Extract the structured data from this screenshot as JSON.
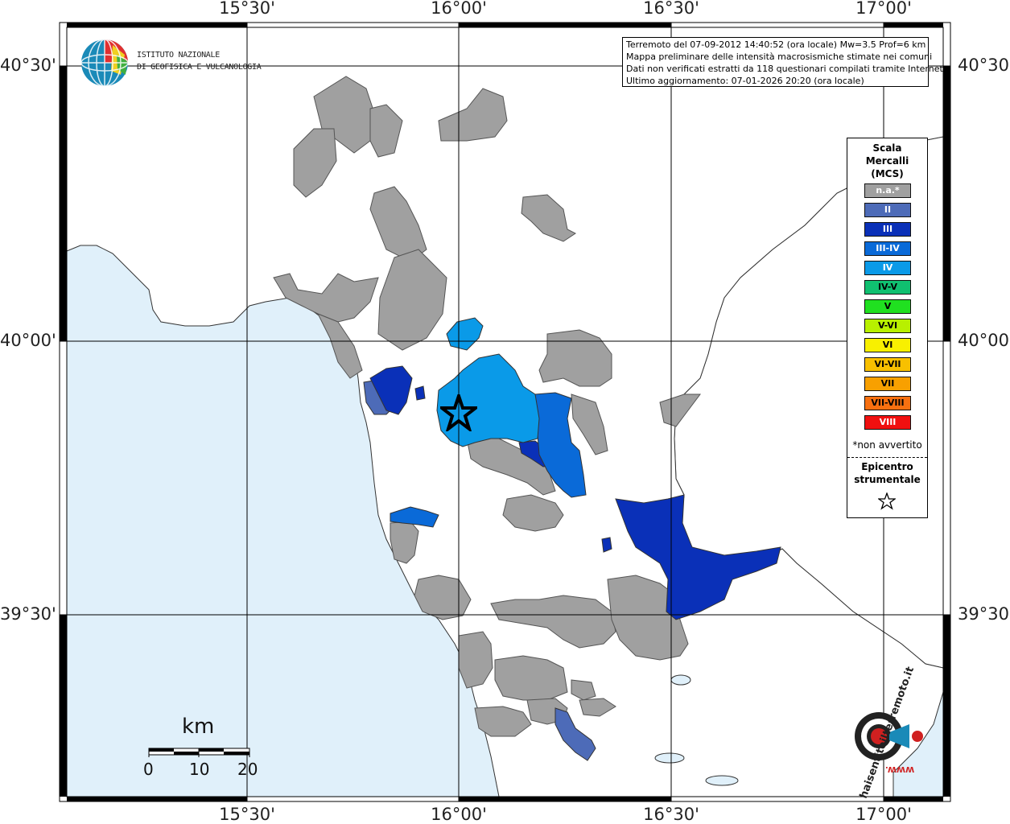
{
  "map": {
    "longitude_labels": [
      "15°30'",
      "16°00'",
      "16°30'",
      "17°00'"
    ],
    "latitude_labels": [
      "40°30'",
      "40°00'",
      "39°30'"
    ],
    "colors": {
      "sea": "#e0f0fa",
      "land": "#ffffff",
      "grid": "#000000"
    }
  },
  "institute": {
    "logo_icon": "ingv-globe-logo",
    "name_line1": "ISTITUTO NAZIONALE",
    "name_line2": "DI GEOFISICA E VULCANOLOGIA"
  },
  "info": {
    "line1": "Terremoto del 07-09-2012 14:40:52 (ora locale) Mw=3.5 Prof=6 km",
    "line2": "Mappa preliminare delle intensità macrosismiche stimate nei comuni",
    "line3": "Dati non verificati estratti da 118 questionari compilati tramite Internet.",
    "line4": "Ultimo aggiornamento: 07-01-2026 20:20 (ora locale)"
  },
  "legend": {
    "title_line1": "Scala",
    "title_line2": "Mercalli",
    "title_line3": "(MCS)",
    "items": [
      {
        "label": "n.a.*",
        "color": "#a0a0a0",
        "text_color": "#ffffff"
      },
      {
        "label": "II",
        "color": "#4d6bb8",
        "text_color": "#ffffff"
      },
      {
        "label": "III",
        "color": "#0a30b8",
        "text_color": "#ffffff"
      },
      {
        "label": "III-IV",
        "color": "#0a6ad8",
        "text_color": "#ffffff"
      },
      {
        "label": "IV",
        "color": "#0a9ae8",
        "text_color": "#ffffff"
      },
      {
        "label": "IV-V",
        "color": "#10c070",
        "text_color": "#000000"
      },
      {
        "label": "V",
        "color": "#20e020",
        "text_color": "#000000"
      },
      {
        "label": "V-VI",
        "color": "#b8f000",
        "text_color": "#000000"
      },
      {
        "label": "VI",
        "color": "#f8f000",
        "text_color": "#000000"
      },
      {
        "label": "VI-VII",
        "color": "#f8c000",
        "text_color": "#000000"
      },
      {
        "label": "VII",
        "color": "#f8a000",
        "text_color": "#000000"
      },
      {
        "label": "VII-VIII",
        "color": "#f87010",
        "text_color": "#000000"
      },
      {
        "label": "VIII",
        "color": "#f01010",
        "text_color": "#ffffff"
      }
    ],
    "footnote": "*non avvertito",
    "epicenter_line1": "Epicentro",
    "epicenter_line2": "strumentale",
    "epicenter_icon": "star-outline-icon"
  },
  "scalebar": {
    "unit": "km",
    "ticks": [
      "0",
      "10",
      "20"
    ]
  },
  "watermark": {
    "brand_text": "haisentitoilterremoto.it",
    "url_text": "WWW.",
    "icon": "target-megaphone-logo"
  }
}
